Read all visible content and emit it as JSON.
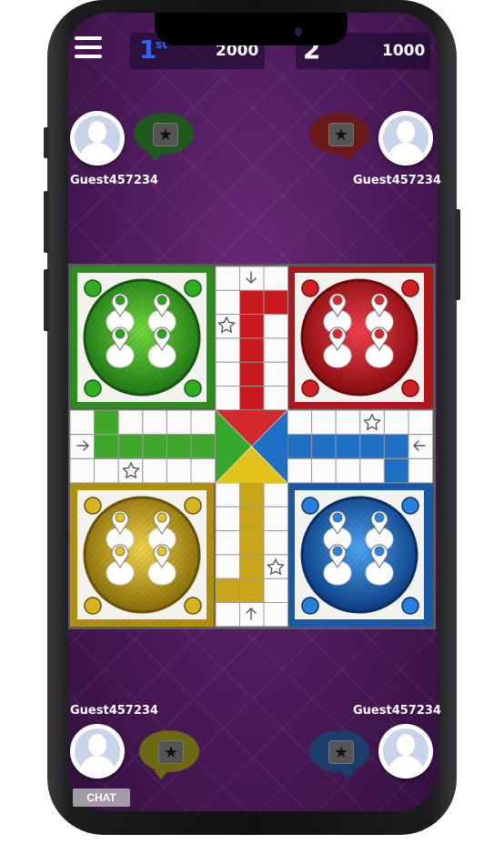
{
  "header": {
    "rank": "1",
    "rank_suffix": "st",
    "score_left": "2000",
    "score_right_rank": "2",
    "score_right": "1000"
  },
  "players": {
    "top_left": {
      "name": "Guest457234",
      "color": "green"
    },
    "top_right": {
      "name": "Guest457234",
      "color": "red"
    },
    "bottom_left": {
      "name": "Guest457234",
      "color": "yellow"
    },
    "bottom_right": {
      "name": "Guest457234",
      "color": "blue"
    }
  },
  "chat_label": "CHAT",
  "colors": {
    "green": "#3fa82a",
    "red": "#c8191c",
    "yellow": "#c9a51a",
    "blue": "#1f6fc4",
    "background": "#4c1a5a"
  },
  "icons": [
    "menu-icon",
    "star-icon",
    "arrow-icon",
    "avatar-icon"
  ]
}
